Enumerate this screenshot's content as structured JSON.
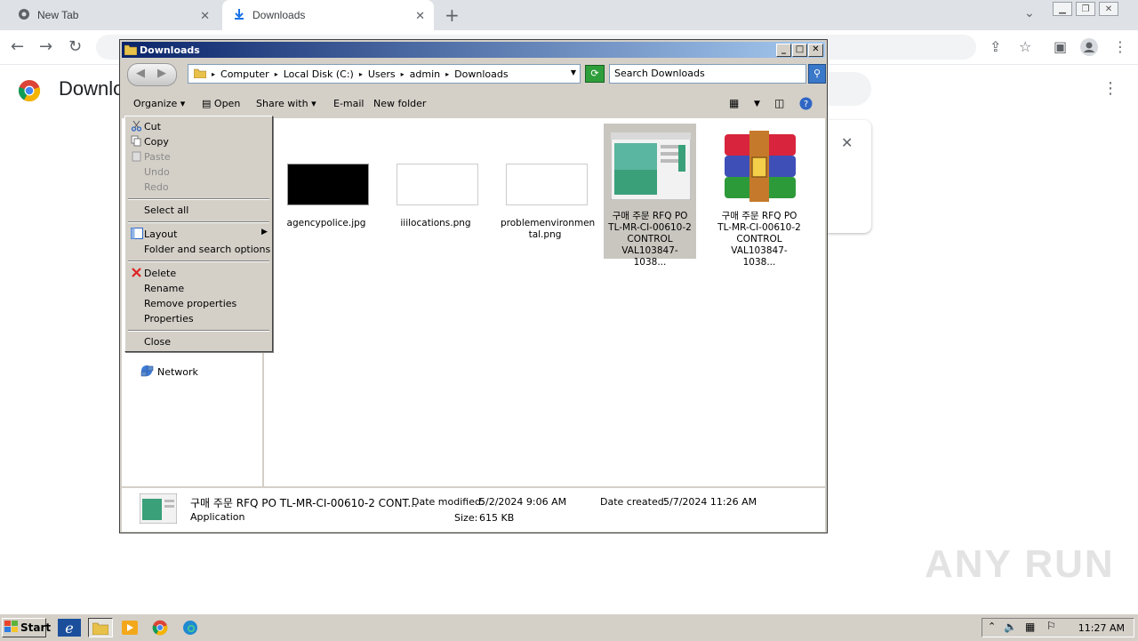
{
  "browser": {
    "tabs": [
      {
        "label": "New Tab"
      },
      {
        "label": "Downloads"
      }
    ],
    "page_heading": "Downloads",
    "watermark": "ANY RUN"
  },
  "explorer": {
    "title": "Downloads",
    "breadcrumb": [
      "Computer",
      "Local Disk (C:)",
      "Users",
      "admin",
      "Downloads"
    ],
    "search_placeholder": "Search Downloads",
    "commands": {
      "organize": "Organize",
      "open": "Open",
      "share_with": "Share with",
      "email": "E-mail",
      "new_folder": "New folder"
    },
    "nav": {
      "network": "Network"
    },
    "files": [
      {
        "name": "agencypolice.jpg"
      },
      {
        "name": "iiilocations.png"
      },
      {
        "name": "problemenvironmen tal.png"
      },
      {
        "name": "구매 주문 RFQ PO TL-MR-CI-00610-2 CONTROL VAL103847-1038..."
      },
      {
        "name": "구매 주문 RFQ PO TL-MR-CI-00610-2 CONTROL VAL103847-1038..."
      }
    ],
    "details": {
      "name": "구매 주문 RFQ PO TL-MR-CI-00610-2 CONT...",
      "type": "Application",
      "date_modified_label": "Date modified:",
      "date_modified": "5/2/2024 9:06 AM",
      "size_label": "Size:",
      "size": "615 KB",
      "date_created_label": "Date created:",
      "date_created": "5/7/2024 11:26 AM"
    }
  },
  "context_menu": {
    "items": {
      "cut": "Cut",
      "copy": "Copy",
      "paste": "Paste",
      "undo": "Undo",
      "redo": "Redo",
      "select_all": "Select all",
      "layout": "Layout",
      "folder_options": "Folder and search options",
      "delete": "Delete",
      "rename": "Rename",
      "remove_properties": "Remove properties",
      "properties": "Properties",
      "close": "Close"
    }
  },
  "taskbar": {
    "start": "Start",
    "clock": "11:27 AM"
  }
}
